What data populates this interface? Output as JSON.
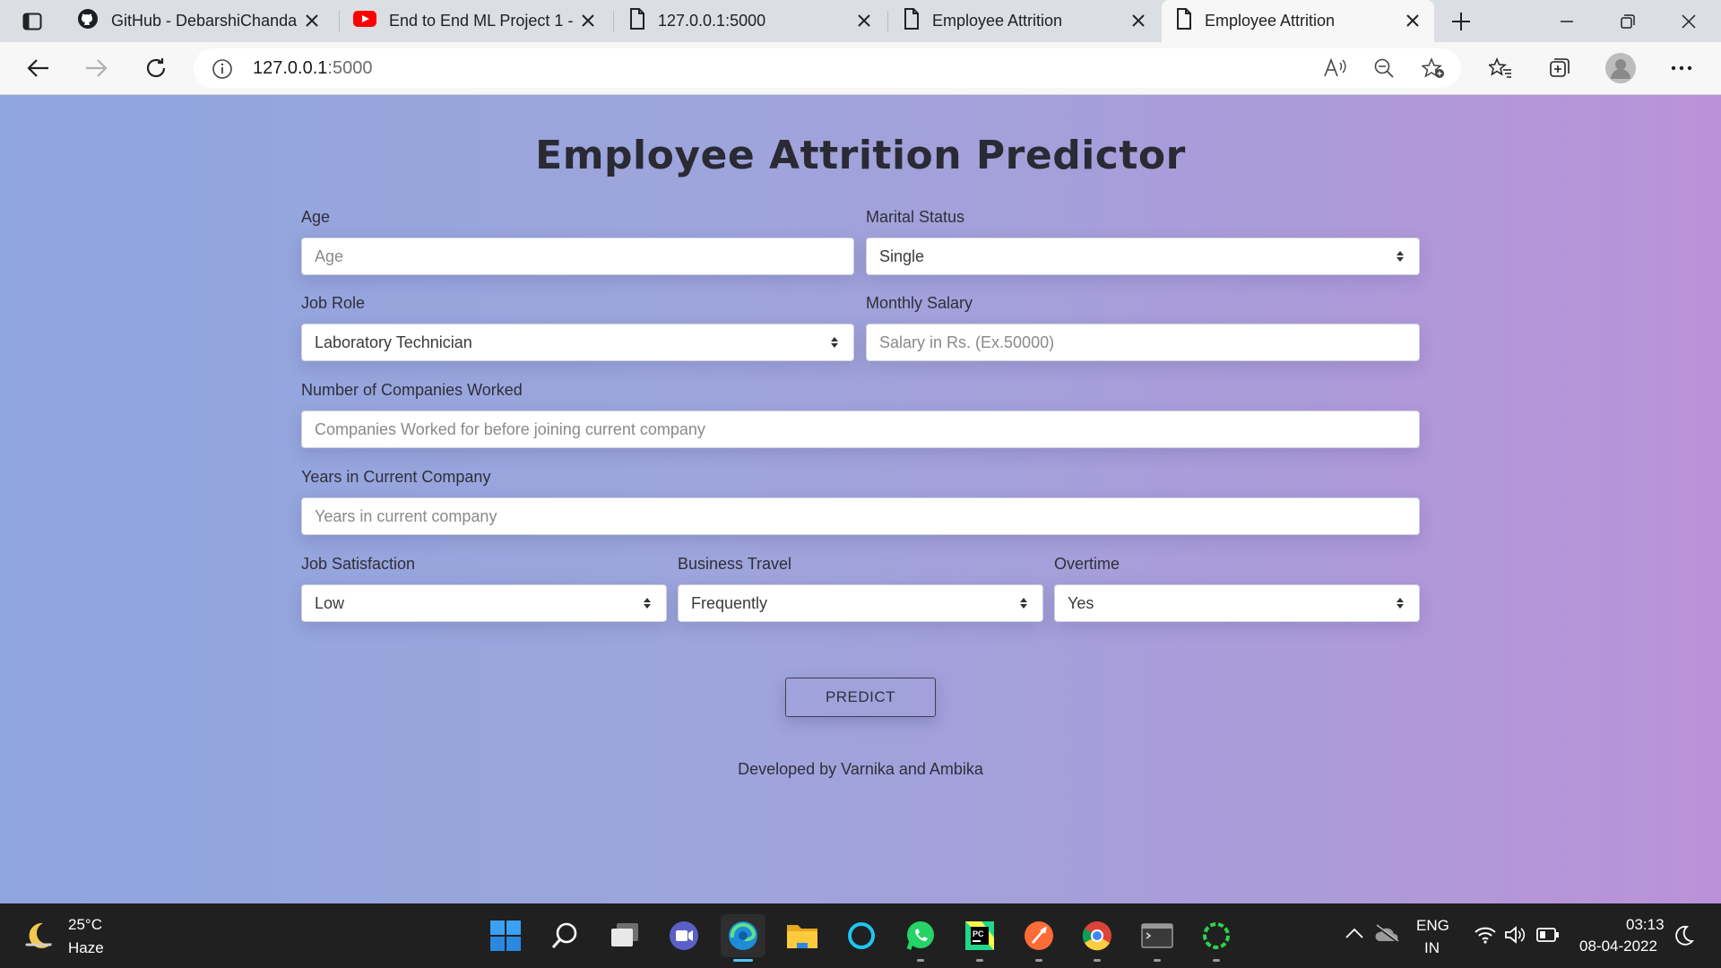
{
  "browser": {
    "tabs": [
      {
        "title": "GitHub - DebarshiChanda",
        "icon": "github-icon",
        "active": false
      },
      {
        "title": "End to End ML Project 1 -",
        "icon": "youtube-icon",
        "active": false
      },
      {
        "title": "127.0.0.1:5000",
        "icon": "page-icon",
        "active": false
      },
      {
        "title": "Employee Attrition",
        "icon": "page-icon",
        "active": false
      },
      {
        "title": "Employee Attrition",
        "icon": "page-icon",
        "active": true
      }
    ],
    "url_host": "127.0.0.1",
    "url_port": ":5000"
  },
  "form": {
    "title": "Employee Attrition Predictor",
    "age": {
      "label": "Age",
      "placeholder": "Age"
    },
    "marital_status": {
      "label": "Marital Status",
      "value": "Single"
    },
    "job_role": {
      "label": "Job Role",
      "value": "Laboratory Technician"
    },
    "monthly_salary": {
      "label": "Monthly Salary",
      "placeholder": "Salary in Rs. (Ex.50000)"
    },
    "companies_worked": {
      "label": "Number of Companies Worked",
      "placeholder": "Companies Worked for before joining current company"
    },
    "years_current": {
      "label": "Years in Current Company",
      "placeholder": "Years in current company"
    },
    "job_satisfaction": {
      "label": "Job Satisfaction",
      "value": "Low"
    },
    "business_travel": {
      "label": "Business Travel",
      "value": "Frequently"
    },
    "overtime": {
      "label": "Overtime",
      "value": "Yes"
    },
    "predict_label": "PREDICT",
    "credit": "Developed by Varnika and Ambika"
  },
  "taskbar": {
    "weather_temp": "25°C",
    "weather_desc": "Haze",
    "lang_line1": "ENG",
    "lang_line2": "IN",
    "time": "03:13",
    "date": "08-04-2022"
  },
  "colors": {
    "page_gradient_start": "#8fa5de",
    "page_gradient_end": "#bb92d9",
    "taskbar": "#202020"
  }
}
